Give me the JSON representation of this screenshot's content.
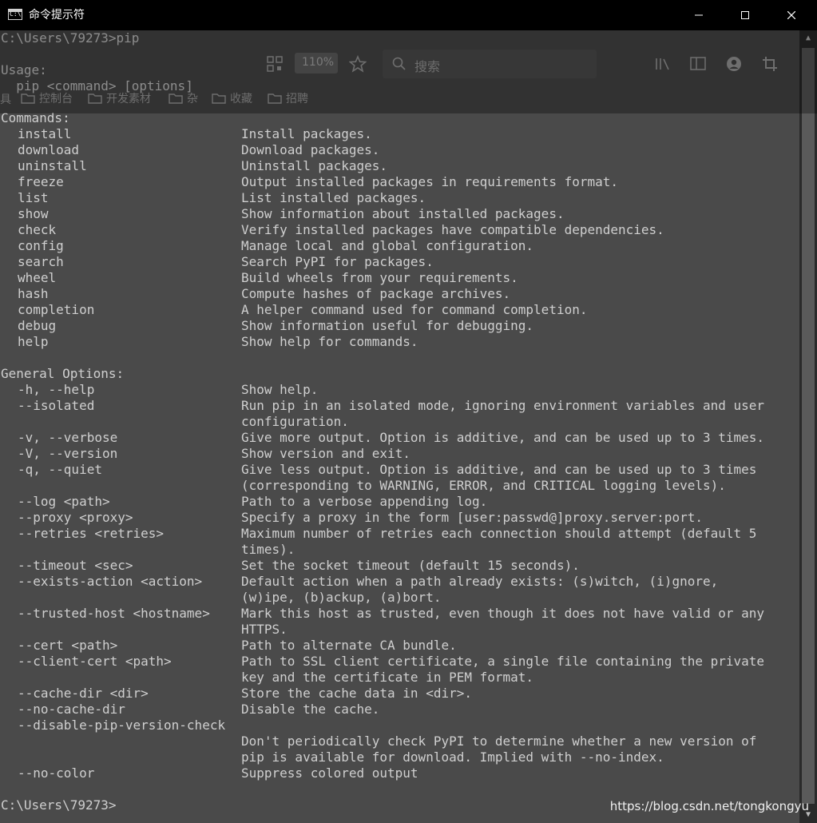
{
  "window": {
    "title": "命令提示符"
  },
  "lines": [
    {
      "text": "C:\\Users\\79273>pip"
    },
    {
      "text": ""
    },
    {
      "text": "Usage:"
    },
    {
      "text": "  pip <command> [options]"
    },
    {
      "text": ""
    },
    {
      "text": "Commands:"
    },
    {
      "cmd": "install",
      "desc": "Install packages."
    },
    {
      "cmd": "download",
      "desc": "Download packages."
    },
    {
      "cmd": "uninstall",
      "desc": "Uninstall packages."
    },
    {
      "cmd": "freeze",
      "desc": "Output installed packages in requirements format."
    },
    {
      "cmd": "list",
      "desc": "List installed packages."
    },
    {
      "cmd": "show",
      "desc": "Show information about installed packages."
    },
    {
      "cmd": "check",
      "desc": "Verify installed packages have compatible dependencies."
    },
    {
      "cmd": "config",
      "desc": "Manage local and global configuration."
    },
    {
      "cmd": "search",
      "desc": "Search PyPI for packages."
    },
    {
      "cmd": "wheel",
      "desc": "Build wheels from your requirements."
    },
    {
      "cmd": "hash",
      "desc": "Compute hashes of package archives."
    },
    {
      "cmd": "completion",
      "desc": "A helper command used for command completion."
    },
    {
      "cmd": "debug",
      "desc": "Show information useful for debugging."
    },
    {
      "cmd": "help",
      "desc": "Show help for commands."
    },
    {
      "text": ""
    },
    {
      "text": "General Options:"
    },
    {
      "cmd": "-h, --help",
      "desc": "Show help."
    },
    {
      "cmd": "--isolated",
      "desc": "Run pip in an isolated mode, ignoring environment variables and user"
    },
    {
      "cmd": "",
      "desc": "configuration."
    },
    {
      "cmd": "-v, --verbose",
      "desc": "Give more output. Option is additive, and can be used up to 3 times."
    },
    {
      "cmd": "-V, --version",
      "desc": "Show version and exit."
    },
    {
      "cmd": "-q, --quiet",
      "desc": "Give less output. Option is additive, and can be used up to 3 times"
    },
    {
      "cmd": "",
      "desc": "(corresponding to WARNING, ERROR, and CRITICAL logging levels)."
    },
    {
      "cmd": "--log <path>",
      "desc": "Path to a verbose appending log."
    },
    {
      "cmd": "--proxy <proxy>",
      "desc": "Specify a proxy in the form [user:passwd@]proxy.server:port."
    },
    {
      "cmd": "--retries <retries>",
      "desc": "Maximum number of retries each connection should attempt (default 5"
    },
    {
      "cmd": "",
      "desc": "times)."
    },
    {
      "cmd": "--timeout <sec>",
      "desc": "Set the socket timeout (default 15 seconds)."
    },
    {
      "cmd": "--exists-action <action>",
      "desc": "Default action when a path already exists: (s)witch, (i)gnore,"
    },
    {
      "cmd": "",
      "desc": "(w)ipe, (b)ackup, (a)bort."
    },
    {
      "cmd": "--trusted-host <hostname>",
      "desc": "Mark this host as trusted, even though it does not have valid or any"
    },
    {
      "cmd": "",
      "desc": "HTTPS."
    },
    {
      "cmd": "--cert <path>",
      "desc": "Path to alternate CA bundle."
    },
    {
      "cmd": "--client-cert <path>",
      "desc": "Path to SSL client certificate, a single file containing the private"
    },
    {
      "cmd": "",
      "desc": "key and the certificate in PEM format."
    },
    {
      "cmd": "--cache-dir <dir>",
      "desc": "Store the cache data in <dir>."
    },
    {
      "cmd": "--no-cache-dir",
      "desc": "Disable the cache."
    },
    {
      "cmd": "--disable-pip-version-check",
      "desc": ""
    },
    {
      "cmd": "",
      "desc": "Don't periodically check PyPI to determine whether a new version of"
    },
    {
      "cmd": "",
      "desc": "pip is available for download. Implied with --no-index."
    },
    {
      "cmd": "--no-color",
      "desc": "Suppress colored output"
    },
    {
      "text": ""
    },
    {
      "text": "C:\\Users\\79273>"
    }
  ],
  "overlay": {
    "zoom": "110%",
    "search_placeholder": "搜索",
    "bookmarks": [
      "控制台",
      "开发素材",
      "杂",
      "收藏",
      "招聘"
    ],
    "left_fragment": "具"
  },
  "watermark": "https://blog.csdn.net/tongkongyu",
  "colors": {
    "background": "#4a4a4a",
    "text": "#cfcfcf",
    "titlebar": "#000000"
  }
}
